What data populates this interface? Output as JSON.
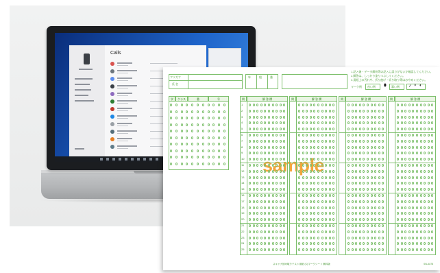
{
  "laptop_app": {
    "title": "Calls",
    "contact_colors": [
      "#d9534f",
      "#6c757d",
      "#5b8def",
      "#3a3f47",
      "#8e6bbf",
      "#2e7d32",
      "#c0392b",
      "#1e88e5",
      "#9aa0a6",
      "#546e7a",
      "#e67e22",
      "#607d8b"
    ]
  },
  "answer_sheet": {
    "header": {
      "furigana_label": "フリガナ",
      "name_label": "氏 名",
      "year_label": "年",
      "class_label": "組",
      "number_label": "番",
      "instructions": [
        "1.記入後・データ解析等の記入に誤りがないか確認してください。",
        "2.解答は、しっかり塗りつぶしてください。",
        "3.用紙上の汚れや、折り曲げ・切り取り等はおやめください。"
      ],
      "mark_example_label": "マーク例",
      "good_label": "良い例",
      "bad_label": "悪い例"
    },
    "id_block": {
      "headers": [
        "学",
        "クラス",
        "番",
        "号"
      ]
    },
    "column_header_number": "問",
    "column_header_answer": "解 答 欄",
    "row_numbers": [
      "1",
      "2",
      "3",
      "4",
      "5",
      "6",
      "7",
      "8",
      "9",
      "10",
      "11",
      "12",
      "13",
      "14",
      "15",
      "16",
      "17",
      "18",
      "19",
      "20",
      "21",
      "22",
      "23",
      "24",
      "25"
    ],
    "watermark": "sample",
    "footer": "スキャナ読み取りテスト用紙 (C)マークシート 無料版",
    "footer_code": "SN-A078"
  }
}
